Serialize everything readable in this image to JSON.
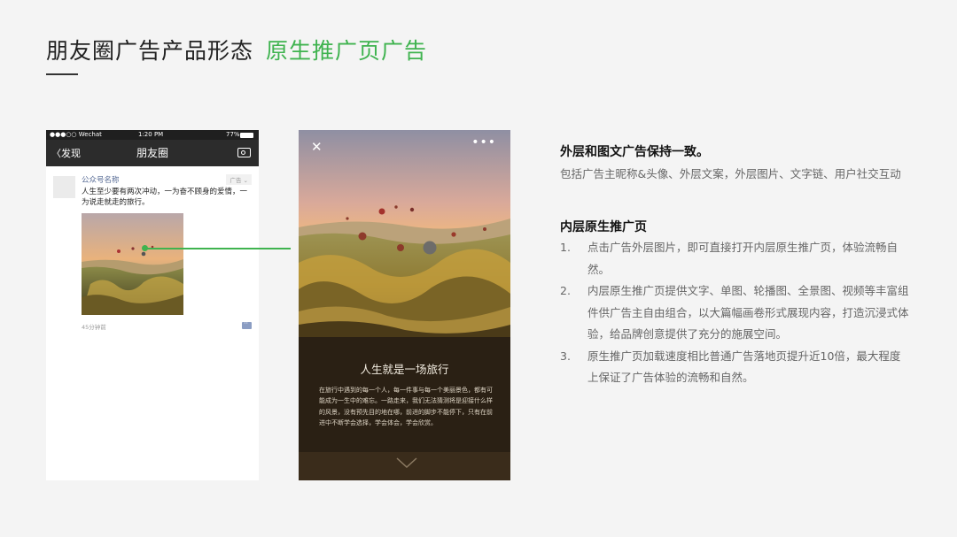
{
  "header": {
    "title_main": "朋友圈广告产品形态",
    "title_highlight": "原生推广页广告"
  },
  "phone_feed": {
    "status_carrier": "●●●○○ Wechat",
    "status_time": "1:20 PM",
    "status_battery": "77%",
    "nav_back": "发现",
    "nav_title": "朋友圈",
    "account_name": "公众号名称",
    "ad_badge": "广告",
    "post_text": "人生至少要有两次冲动，一为奋不顾身的爱情，一为说走就走的旅行。",
    "post_time": "45分钟前"
  },
  "phone_landing": {
    "close_icon": "close-icon",
    "heading": "人生就是一场旅行",
    "body": "在旅行中遇到的每一个人，每一件事与每一个美丽景色，都有可能成为一生中的难忘。一路走来，我们无法猜测将是迎接什么样的风景，没有预先目的地在哪，前进的脚步不能停下，只有在前进中不断学会选择，学会体会，学会欣赏。"
  },
  "info": {
    "section1_title": "外层和图文广告保持一致。",
    "section1_body": "包括广告主昵称&头像、外层文案，外层图片、文字链、用户社交互动",
    "section2_title": "内层原生推广页",
    "items": [
      {
        "num": "1.",
        "text": "点击广告外层图片，即可直接打开内层原生推广页，体验流畅自然。"
      },
      {
        "num": "2.",
        "text": "内层原生推广页提供文字、单图、轮播图、全景图、视频等丰富组件供广告主自由组合，以大篇幅画卷形式展现内容，打造沉浸式体验，给品牌创意提供了充分的施展空间。"
      },
      {
        "num": "3.",
        "text": "原生推广页加载速度相比普通广告落地页提升近10倍，最大程度上保证了广告体验的流畅和自然。"
      }
    ]
  },
  "colors": {
    "accent_green": "#3fb34f",
    "link_blue": "#576b95"
  }
}
